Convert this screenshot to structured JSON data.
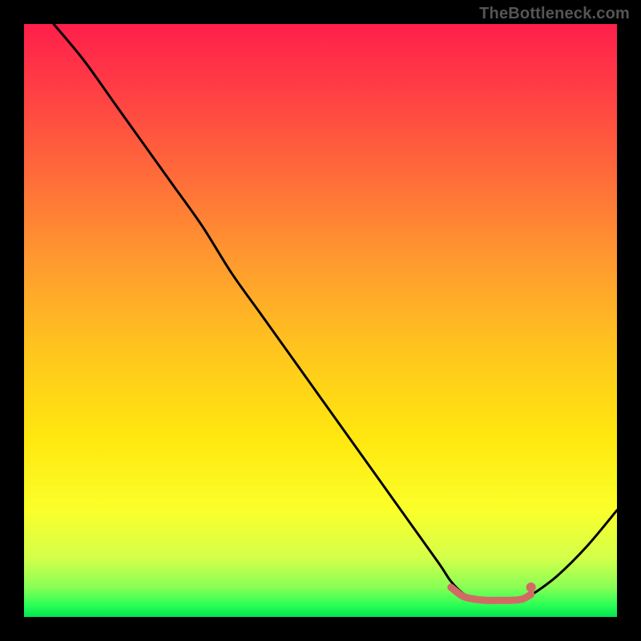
{
  "watermark": "TheBottleneck.com",
  "chart_data": {
    "type": "line",
    "title": "",
    "xlabel": "",
    "ylabel": "",
    "xlim": [
      0,
      100
    ],
    "ylim": [
      0,
      100
    ],
    "grid": false,
    "series": [
      {
        "name": "bottleneck-curve",
        "color": "#000000",
        "x": [
          5,
          10,
          15,
          20,
          25,
          30,
          35,
          40,
          45,
          50,
          55,
          60,
          65,
          70,
          72,
          74,
          76,
          78,
          80,
          82,
          84,
          86,
          90,
          95,
          100
        ],
        "values": [
          100,
          94,
          87,
          80,
          73,
          66,
          58,
          51,
          44,
          37,
          30,
          23,
          16,
          9,
          6,
          4,
          3,
          2.5,
          2.5,
          2.5,
          3,
          4,
          7,
          12,
          18
        ]
      },
      {
        "name": "highlight-band",
        "color": "#d26a64",
        "x": [
          72,
          74,
          76,
          78,
          80,
          82,
          84,
          85.5
        ],
        "values": [
          5,
          3.5,
          3,
          2.8,
          2.8,
          2.8,
          3,
          3.8
        ]
      }
    ],
    "markers": [
      {
        "name": "highlight-dot",
        "x": 85.5,
        "y": 5,
        "color": "#d26a64"
      }
    ],
    "background_gradient": {
      "direction": "vertical",
      "stops": [
        {
          "pos": 0.0,
          "color": "#ff1f4b"
        },
        {
          "pos": 0.1,
          "color": "#ff3b45"
        },
        {
          "pos": 0.25,
          "color": "#ff6a3a"
        },
        {
          "pos": 0.4,
          "color": "#ff9a2f"
        },
        {
          "pos": 0.55,
          "color": "#ffc51e"
        },
        {
          "pos": 0.7,
          "color": "#ffe80f"
        },
        {
          "pos": 0.82,
          "color": "#fbff2a"
        },
        {
          "pos": 0.9,
          "color": "#d4ff4a"
        },
        {
          "pos": 0.95,
          "color": "#88ff55"
        },
        {
          "pos": 0.98,
          "color": "#2bff55"
        },
        {
          "pos": 1.0,
          "color": "#00e552"
        }
      ]
    }
  }
}
